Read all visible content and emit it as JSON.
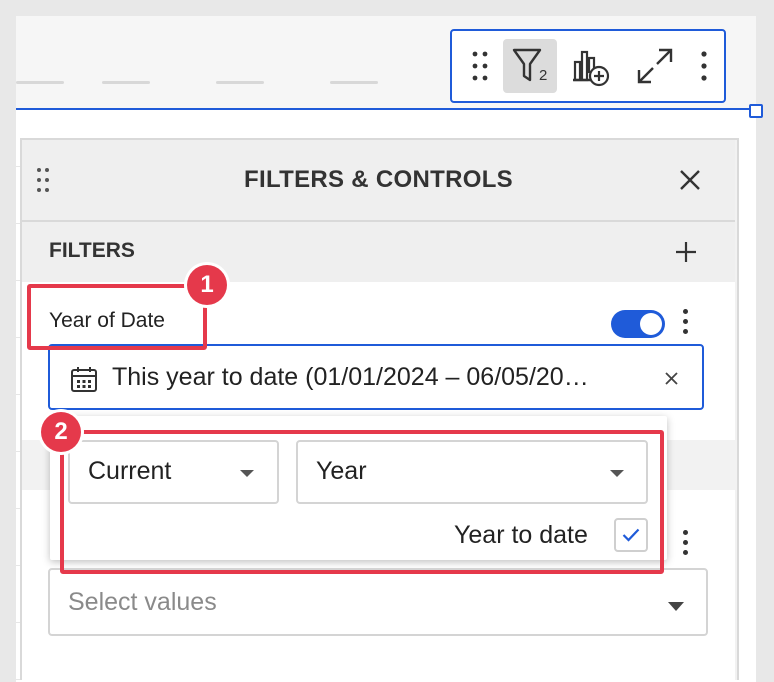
{
  "toolbar": {
    "filter_count": "2",
    "icons": [
      "drag-handle-icon",
      "filter-icon",
      "add-chart-icon",
      "expand-icon",
      "more-icon"
    ]
  },
  "panel": {
    "title": "FILTERS & CONTROLS",
    "filters_label": "FILTERS"
  },
  "filter": {
    "name": "Year of Date",
    "enabled": true,
    "value": "This year to date (01/01/2024 – 06/05/20…",
    "period_select": "Current",
    "unit_select": "Year",
    "to_date_label": "Year to date",
    "to_date_checked": true
  },
  "second_filter": {
    "placeholder": "Select values"
  },
  "annotations": {
    "badge_1": "1",
    "badge_2": "2",
    "highlight_color": "#e5394b"
  },
  "colors": {
    "accent": "#1f5bd9"
  }
}
